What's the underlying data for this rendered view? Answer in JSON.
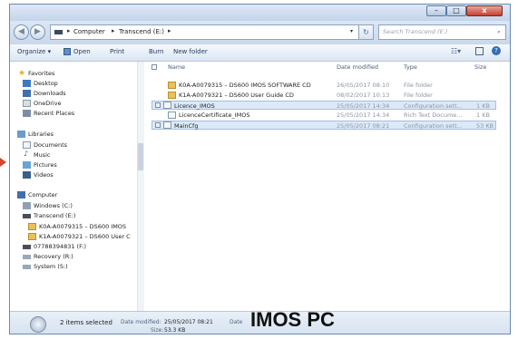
{
  "window": {
    "minimize": "–",
    "maximize": "□",
    "close": "x"
  },
  "address": {
    "crumb1": "Computer",
    "crumb2": "Transcend (E:)",
    "search_placeholder": "Search Transcend (E:)"
  },
  "toolbar": {
    "organize": "Organize ▾",
    "open": "Open",
    "print": "Print",
    "burn": "Burn",
    "new_folder": "New folder"
  },
  "nav": {
    "favorites": "Favorites",
    "desktop": "Desktop",
    "downloads": "Downloads",
    "onedrive": "OneDrive",
    "recent": "Recent Places",
    "libraries": "Libraries",
    "documents": "Documents",
    "music": "Music",
    "pictures": "Pictures",
    "videos": "Videos",
    "computer": "Computer",
    "windows": "Windows (C:)",
    "transcend": "Transcend (E:)",
    "sub1": "K0A-A0079315 – DS600 IMOS",
    "sub2": "K1A-A0079321 – DS600 User C",
    "drive_f": "07788394831 (F:)",
    "recovery": "Recovery (R:)",
    "system": "System (S:)"
  },
  "columns": {
    "name": "Name",
    "date": "Date modified",
    "type": "Type",
    "size": "Size"
  },
  "files": [
    {
      "name": "K0A-A0079315 – DS600 IMOS SOFTWARE CD",
      "date": "26/05/2017 08:10",
      "type": "File folder",
      "size": ""
    },
    {
      "name": "K1A-A0079321 – DS600 User Guide CD",
      "date": "08/02/2017 10:13",
      "type": "File folder",
      "size": ""
    },
    {
      "name": "Licence_IMOS",
      "date": "25/05/2017 14:34",
      "type": "Configuration sett...",
      "size": "1 KB"
    },
    {
      "name": "LicenceCertificate_IMOS",
      "date": "25/05/2017 14:34",
      "type": "Rich Text Docume...",
      "size": "1 KB"
    },
    {
      "name": "MainCfg",
      "date": "25/05/2017 08:21",
      "type": "Configuration sett...",
      "size": "53 KB"
    }
  ],
  "status": {
    "selected": "2 items selected",
    "date_label": "Date modified:",
    "date_value": "25/05/2017 08:21",
    "size_label": "Size:",
    "size_value": "53.3 KB",
    "date2_label": "Date"
  },
  "caption": "IMOS PC",
  "colors": {
    "accent": "#3a6ea5",
    "selection": "#dce9f8",
    "arrow": "#d8452c"
  }
}
